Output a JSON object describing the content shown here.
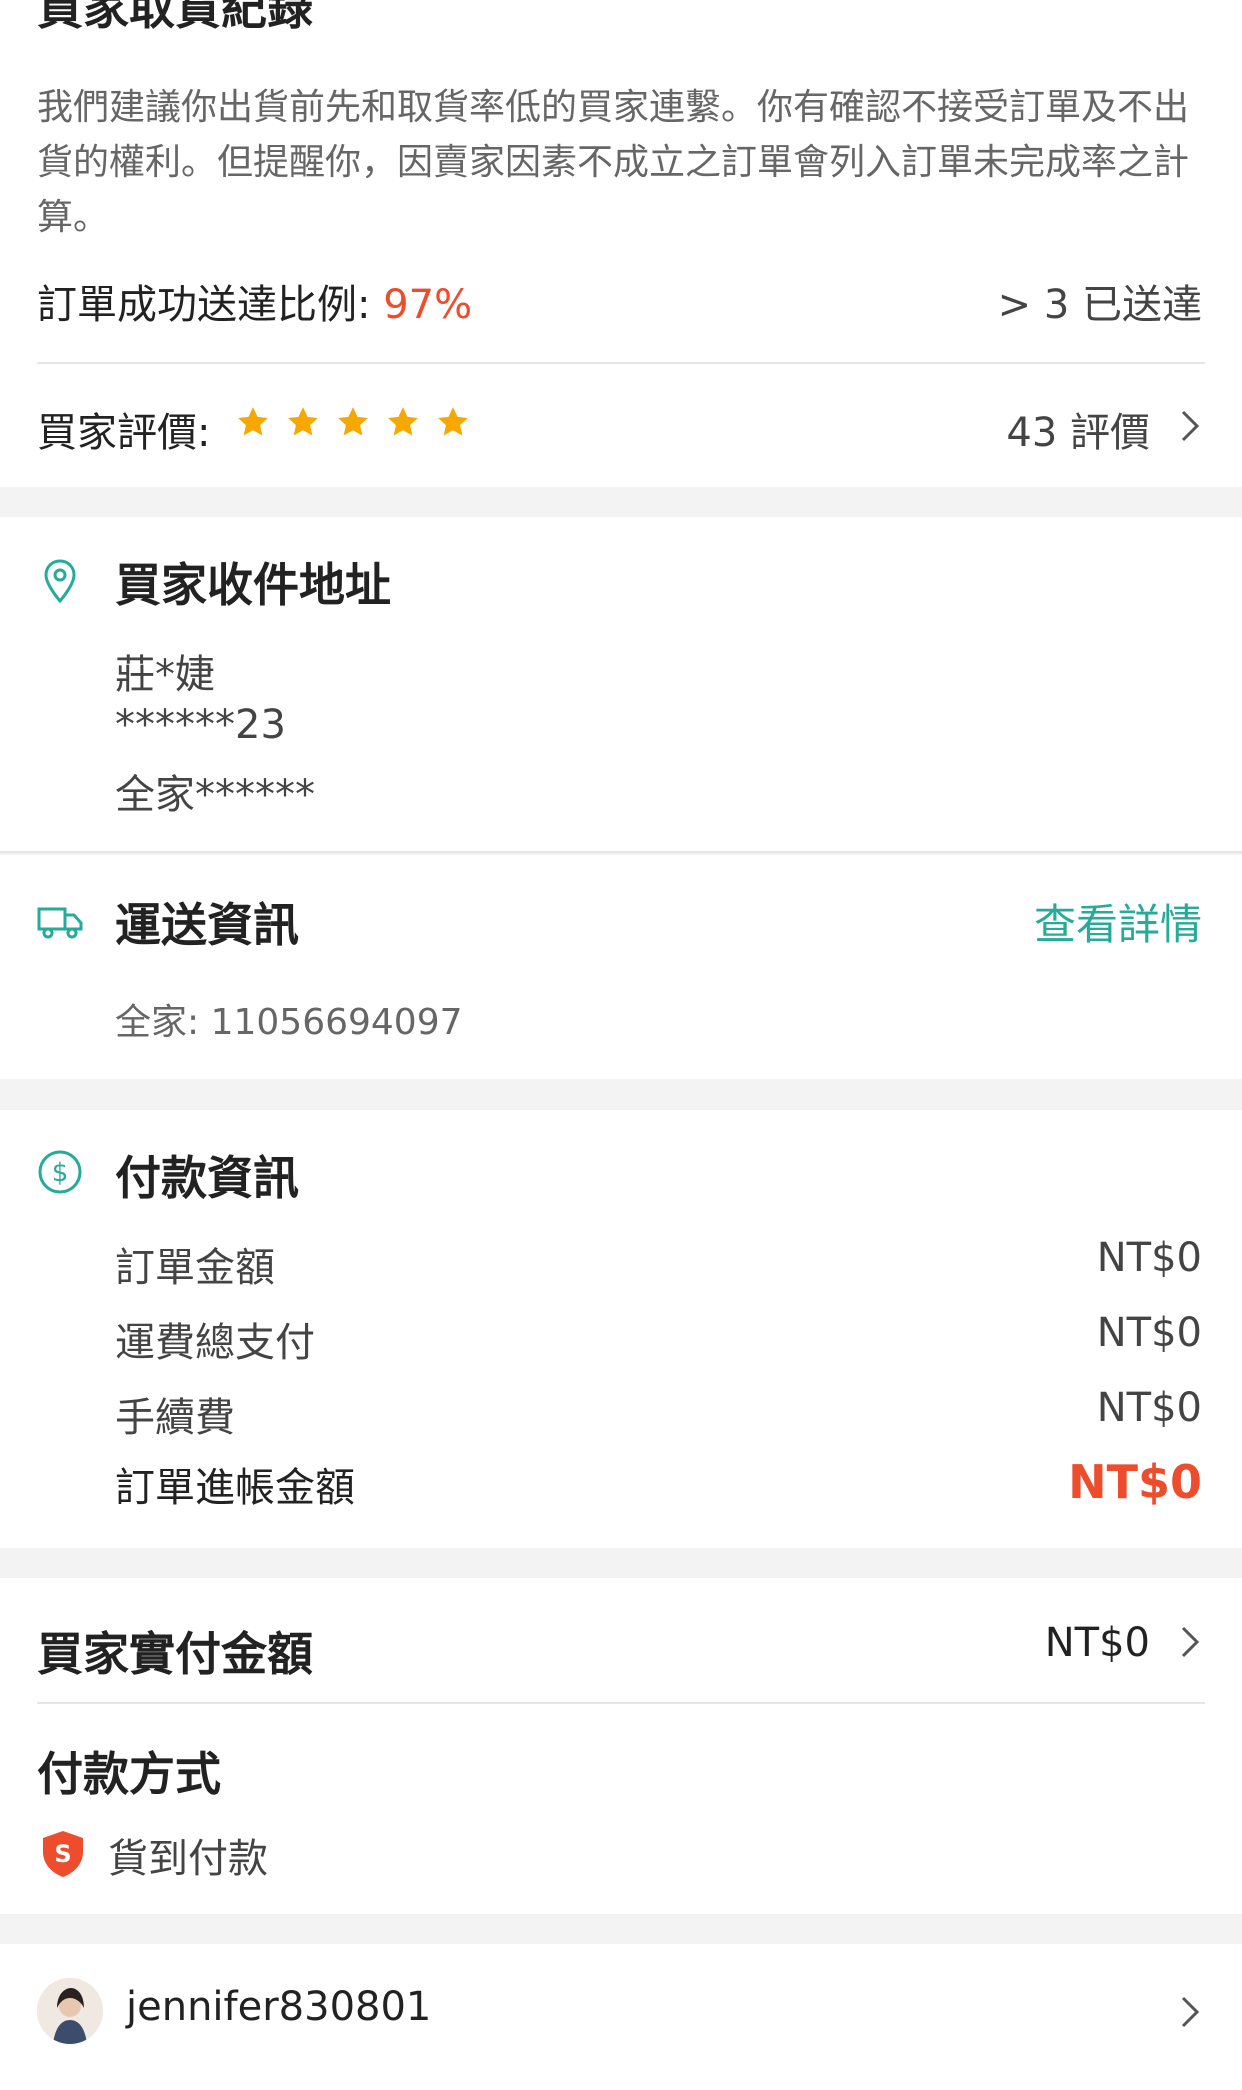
{
  "record": {
    "title": "買家取貨紀錄",
    "description": "我們建議你出貨前先和取貨率低的買家連繫。你有確認不接受訂單及不出貨的權利。但提醒你，因賣家因素不成立之訂單會列入訂單未完成率之計算。",
    "rate_label": "訂單成功送達比例: ",
    "rate_value": "97%",
    "delivered": "> 3 已送達",
    "rating_label": "買家評價:",
    "rating_stars": 5,
    "reviews": "43 評價"
  },
  "address": {
    "title": "買家收件地址",
    "name": "莊*婕",
    "phone": "******23",
    "store": "全家******"
  },
  "shipping": {
    "title": "運送資訊",
    "link": "查看詳情",
    "tracking": "全家: 11056694097"
  },
  "payment_info": {
    "title": "付款資訊",
    "rows": [
      {
        "label": "訂單金額",
        "amount": "NT$0"
      },
      {
        "label": "運費總支付",
        "amount": "NT$0"
      },
      {
        "label": "手續費",
        "amount": "NT$0"
      }
    ],
    "total_label": "訂單進帳金額",
    "total_amount": "NT$0"
  },
  "buyer_paid": {
    "label": "買家實付金額",
    "amount": "NT$0"
  },
  "payment_method": {
    "title": "付款方式",
    "name": "貨到付款"
  },
  "buyer": {
    "username": "jennifer830801"
  },
  "colors": {
    "accent_orange": "#ee4d2d",
    "accent_teal": "#26aa99",
    "star": "#f6a700"
  }
}
